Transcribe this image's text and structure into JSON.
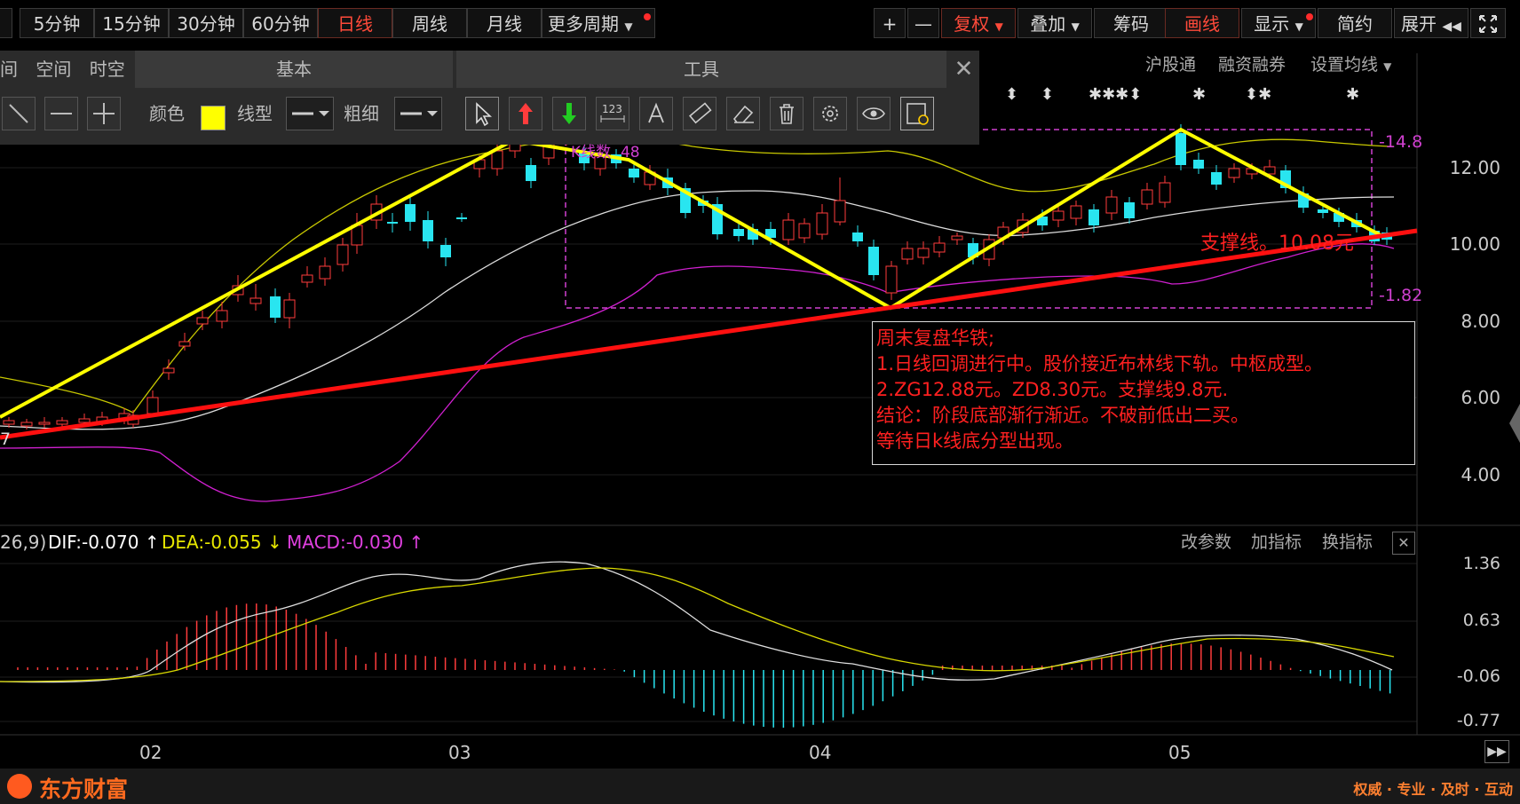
{
  "toolbar": {
    "periods": [
      "5分钟",
      "15分钟",
      "30分钟",
      "60分钟",
      "日线",
      "周线",
      "月线",
      "更多周期"
    ],
    "active_period": "日线",
    "right_buttons": [
      "复权",
      "叠加",
      "筹码",
      "画线",
      "显示",
      "简约",
      "展开"
    ],
    "plus": "+",
    "minus": "—"
  },
  "draw_panel": {
    "left_tabs": [
      "间",
      "空间",
      "时空"
    ],
    "basic_title": "基本",
    "tools_title": "工具",
    "color_label": "颜色",
    "linetype_label": "线型",
    "thickness_label": "粗细",
    "color_value": "#ffff00",
    "ruler_text": "123"
  },
  "chart_nav": [
    "沪股通",
    "融资融券",
    "设置均线"
  ],
  "price_axis": [
    "12.00",
    "10.00",
    "8.00",
    "6.00",
    "4.00"
  ],
  "box_labels": {
    "top": "-14.8",
    "bottom": "-1.82",
    "kline_count": "K线数",
    "kline_count_value": "48",
    "left_edge": "7"
  },
  "support_label": "支撑线。10.08元",
  "note": {
    "lines": [
      "周末复盘华铁;",
      "1.日线回调进行中。股价接近布林线下轨。中枢成型。",
      "2.ZG12.88元。ZD8.30元。支撑线9.8元.",
      "结论：阶段底部渐行渐近。不破前低出二买。",
      "等待日k线底分型出现。"
    ]
  },
  "indicator": {
    "params": "26,9)",
    "dif_label": "DIF:-0.070",
    "dea_label": "DEA:-0.055",
    "macd_label": "MACD:-0.030",
    "buttons": [
      "改参数",
      "加指标",
      "换指标"
    ],
    "axis": [
      "1.36",
      "0.63",
      "-0.06",
      "-0.77"
    ]
  },
  "time_axis": [
    "02",
    "03",
    "04",
    "05"
  ],
  "footer": {
    "brand": "东方财富",
    "slogan": "权威 · 专业 · 及时 · 互动"
  },
  "colors": {
    "up": "#ff3c3c",
    "down": "#29e5f0",
    "yellow": "#ffff00",
    "red_line": "#ff1010",
    "magenta": "#e040e0",
    "active": "#ff4a3a"
  }
}
